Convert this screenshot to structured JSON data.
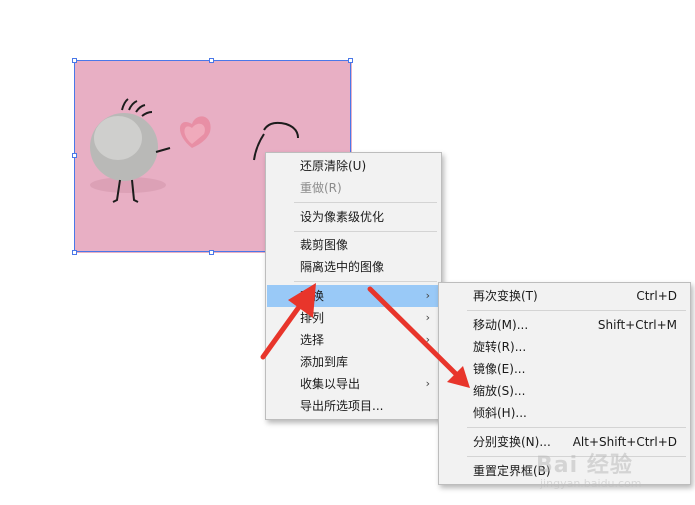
{
  "context_menu": {
    "items": [
      {
        "label": "还原清除(U)",
        "disabled": false
      },
      {
        "label": "重做(R)",
        "disabled": true
      },
      {
        "label": "设为像素级优化"
      },
      {
        "label": "裁剪图像"
      },
      {
        "label": "隔离选中的图像"
      },
      {
        "label": "变换",
        "submenu": true,
        "highlighted": true
      },
      {
        "label": "排列",
        "submenu": true
      },
      {
        "label": "选择",
        "submenu": true
      },
      {
        "label": "添加到库"
      },
      {
        "label": "收集以导出",
        "submenu": true
      },
      {
        "label": "导出所选项目..."
      }
    ]
  },
  "transform_submenu": {
    "items": [
      {
        "label": "再次变换(T)",
        "shortcut": "Ctrl+D"
      },
      {
        "label": "移动(M)...",
        "shortcut": "Shift+Ctrl+M"
      },
      {
        "label": "旋转(R)..."
      },
      {
        "label": "镜像(E)..."
      },
      {
        "label": "缩放(S)..."
      },
      {
        "label": "倾斜(H)..."
      },
      {
        "label": "分别变换(N)...",
        "shortcut": "Alt+Shift+Ctrl+D"
      },
      {
        "label": "重置定界框(B)"
      }
    ]
  },
  "watermark": {
    "text": "Bai 经验",
    "url": "jingyan.baidu.com"
  },
  "colors": {
    "highlight": "#99c9f7",
    "selection": "#4a78e8",
    "annotation": "#e8352b",
    "photo_bg": "#e7aec3"
  }
}
